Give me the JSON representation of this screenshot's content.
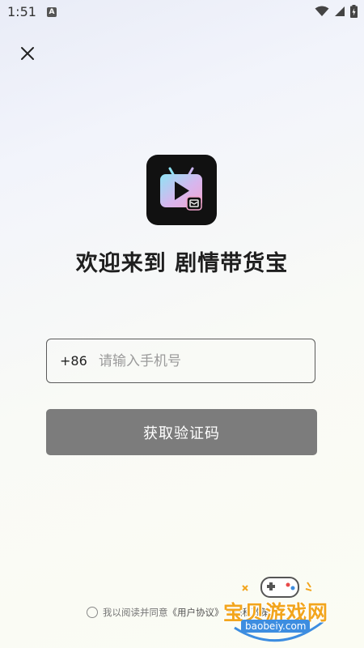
{
  "status_bar": {
    "time": "1:51",
    "notification_icon": "a-letter-icon",
    "icons": [
      "wifi-icon",
      "signal-icon",
      "battery-icon"
    ]
  },
  "header": {
    "close_icon": "close-icon"
  },
  "app": {
    "logo_icon": "tv-play-icon",
    "welcome_title": "欢迎来到 剧情带货宝"
  },
  "login_form": {
    "country_code": "+86",
    "phone_value": "",
    "phone_placeholder": "请输入手机号",
    "get_code_label": "获取验证码"
  },
  "agreement": {
    "prefix": "我以阅读并同意",
    "user_agreement": "《用户协议》",
    "privacy_policy": "《隐私政策》"
  },
  "watermark": {
    "name": "宝贝游戏网",
    "url": "baobeiy.com"
  },
  "colors": {
    "button_bg": "#7c7c7c",
    "logo_bg": "#111111",
    "watermark_orange": "#f2a51d",
    "watermark_blue": "#3d8de0"
  }
}
